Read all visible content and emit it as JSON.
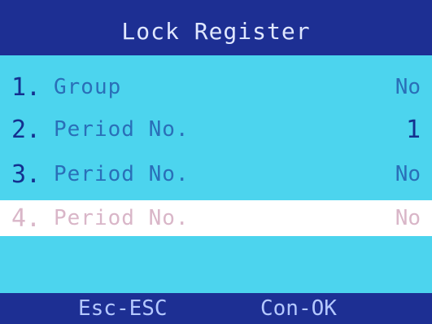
{
  "title": "Lock Register",
  "items": [
    {
      "num": "1.",
      "label": "Group",
      "value": "No"
    },
    {
      "num": "2.",
      "label": "Period No.",
      "value": "1"
    },
    {
      "num": "3.",
      "label": "Period No.",
      "value": "No"
    },
    {
      "num": "4.",
      "label": "Period No.",
      "value": "No"
    }
  ],
  "footer": {
    "esc": "Esc-ESC",
    "ok": "Con-OK"
  },
  "colors": {
    "title_bg": "#1d2f93",
    "menu_bg": "#4cd4ee",
    "selected_bg": "#ffffff",
    "text_dark": "#14308f",
    "text_mid": "#2a6fb8"
  }
}
